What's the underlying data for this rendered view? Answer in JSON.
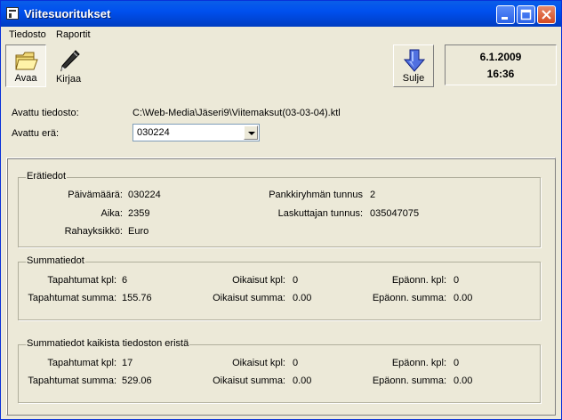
{
  "window": {
    "title": "Viitesuoritukset",
    "icon": "app-window-icon"
  },
  "menu": {
    "items": [
      "Tiedosto",
      "Raportit"
    ]
  },
  "toolbar": {
    "open_label": "Avaa",
    "write_label": "Kirjaa",
    "close_label": "Sulje",
    "date": "6.1.2009",
    "time": "16:36"
  },
  "file": {
    "opened_file_label": "Avattu tiedosto:",
    "opened_file_path": "C:\\Web-Media\\Jäseri9\\Viitemaksut(03-03-04).ktl",
    "opened_batch_label": "Avattu erä:",
    "opened_batch_value": "030224"
  },
  "batch_info": {
    "legend": "Erätiedot",
    "date_label": "Päivämäärä:",
    "date_value": "030224",
    "time_label": "Aika:",
    "time_value": "2359",
    "currency_label": "Rahayksikkö:",
    "currency_value": "Euro",
    "bank_group_label": "Pankkiryhmän tunnus",
    "bank_group_value": "2",
    "biller_label": "Laskuttajan tunnus:",
    "biller_value": "035047075"
  },
  "summary": {
    "legend": "Summatiedot",
    "events_count_label": "Tapahtumat kpl:",
    "events_count_value": "6",
    "events_sum_label": "Tapahtumat summa:",
    "events_sum_value": "155.76",
    "corrections_count_label": "Oikaisut kpl:",
    "corrections_count_value": "0",
    "corrections_sum_label": "Oikaisut summa:",
    "corrections_sum_value": "0.00",
    "failed_count_label": "Epäonn. kpl:",
    "failed_count_value": "0",
    "failed_sum_label": "Epäonn. summa:",
    "failed_sum_value": "0.00"
  },
  "summary_all": {
    "legend": "Summatiedot kaikista tiedoston eristä",
    "events_count_label": "Tapahtumat kpl:",
    "events_count_value": "17",
    "events_sum_label": "Tapahtumat summa:",
    "events_sum_value": "529.06",
    "corrections_count_label": "Oikaisut kpl:",
    "corrections_count_value": "0",
    "corrections_sum_label": "Oikaisut summa:",
    "corrections_sum_value": "0.00",
    "failed_count_label": "Epäonn. kpl:",
    "failed_count_value": "0",
    "failed_sum_label": "Epäonn. summa:",
    "failed_sum_value": "0.00"
  }
}
